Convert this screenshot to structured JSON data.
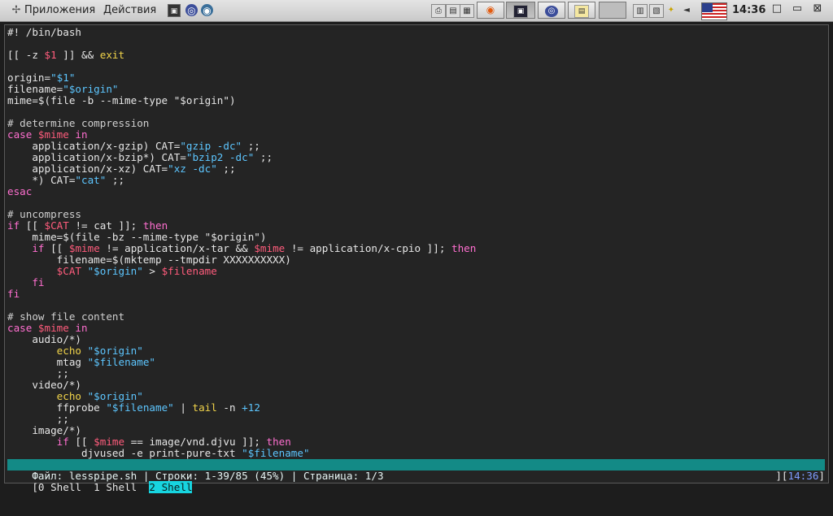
{
  "panel": {
    "menus": [
      "Приложения",
      "Действия"
    ],
    "quicklaunch": [
      {
        "icon": "terminal-icon",
        "glyph": "▣"
      },
      {
        "icon": "app-launcher-icon",
        "glyph": "◎"
      },
      {
        "icon": "browser-icon",
        "glyph": "◉"
      }
    ],
    "tray_left": [
      {
        "icon": "printer-icon",
        "glyph": "⎙"
      },
      {
        "icon": "notes-icon",
        "glyph": "▤"
      },
      {
        "icon": "network-icon",
        "glyph": "▦"
      }
    ],
    "tasks": [
      {
        "name": "task-firefox",
        "glyph": "◉"
      },
      {
        "name": "task-terminal",
        "glyph": "▣"
      },
      {
        "name": "task-app",
        "glyph": "◎"
      },
      {
        "name": "task-editor",
        "glyph": "▤"
      }
    ],
    "tray_right": [
      {
        "icon": "files-icon",
        "glyph": "▥"
      },
      {
        "icon": "clipboard-icon",
        "glyph": "▧"
      },
      {
        "icon": "weather-icon",
        "glyph": "✦"
      },
      {
        "icon": "volume-icon",
        "glyph": "◄"
      }
    ],
    "clock": "14:36",
    "window_buttons": {
      "maximize": "□",
      "minimize": "▭",
      "close": "⊠"
    }
  },
  "terminal": {
    "lines": [
      [
        [
          "plain",
          "#! /bin/bash"
        ]
      ],
      [],
      [
        [
          "plain",
          "[[ -z "
        ],
        [
          "var",
          "$1"
        ],
        [
          "plain",
          " ]] && "
        ],
        [
          "cmd",
          "exit"
        ]
      ],
      [],
      [
        [
          "plain",
          "origin="
        ],
        [
          "str",
          "\"$1\""
        ]
      ],
      [
        [
          "plain",
          "filename="
        ],
        [
          "str",
          "\"$origin\""
        ]
      ],
      [
        [
          "plain",
          "mime=$(file -b --mime-type \"$origin\")"
        ]
      ],
      [],
      [
        [
          "comment",
          "# determine compression"
        ]
      ],
      [
        [
          "kw",
          "case "
        ],
        [
          "var",
          "$mime"
        ],
        [
          "kw",
          " in"
        ]
      ],
      [
        [
          "plain",
          "    application/x-gzip) CAT="
        ],
        [
          "str",
          "\"gzip -dc\""
        ],
        [
          "plain",
          " ;;"
        ]
      ],
      [
        [
          "plain",
          "    application/x-bzip*) CAT="
        ],
        [
          "str",
          "\"bzip2 -dc\""
        ],
        [
          "plain",
          " ;;"
        ]
      ],
      [
        [
          "plain",
          "    application/x-xz) CAT="
        ],
        [
          "str",
          "\"xz -dc\""
        ],
        [
          "plain",
          " ;;"
        ]
      ],
      [
        [
          "plain",
          "    *) CAT="
        ],
        [
          "str",
          "\"cat\""
        ],
        [
          "plain",
          " ;;"
        ]
      ],
      [
        [
          "kw",
          "esac"
        ]
      ],
      [],
      [
        [
          "comment",
          "# uncompress"
        ]
      ],
      [
        [
          "kw",
          "if"
        ],
        [
          "plain",
          " [[ "
        ],
        [
          "var",
          "$CAT"
        ],
        [
          "plain",
          " != cat ]]; "
        ],
        [
          "kw",
          "then"
        ]
      ],
      [
        [
          "plain",
          "    mime=$(file -bz --mime-type \"$origin\")"
        ]
      ],
      [
        [
          "plain",
          "    "
        ],
        [
          "kw",
          "if"
        ],
        [
          "plain",
          " [[ "
        ],
        [
          "var",
          "$mime"
        ],
        [
          "plain",
          " != application/x-tar && "
        ],
        [
          "var",
          "$mime"
        ],
        [
          "plain",
          " != application/x-cpio ]]; "
        ],
        [
          "kw",
          "then"
        ]
      ],
      [
        [
          "plain",
          "        filename=$(mktemp --tmpdir XXXXXXXXXX)"
        ]
      ],
      [
        [
          "plain",
          "        "
        ],
        [
          "var",
          "$CAT"
        ],
        [
          "str",
          " \"$origin\""
        ],
        [
          "plain",
          " > "
        ],
        [
          "var",
          "$filename"
        ]
      ],
      [
        [
          "plain",
          "    "
        ],
        [
          "kw",
          "fi"
        ]
      ],
      [
        [
          "kw",
          "fi"
        ]
      ],
      [],
      [
        [
          "comment",
          "# show file content"
        ]
      ],
      [
        [
          "kw",
          "case "
        ],
        [
          "var",
          "$mime"
        ],
        [
          "kw",
          " in"
        ]
      ],
      [
        [
          "plain",
          "    audio/*)"
        ]
      ],
      [
        [
          "plain",
          "        "
        ],
        [
          "cmd",
          "echo"
        ],
        [
          "str",
          " \"$origin\""
        ]
      ],
      [
        [
          "plain",
          "        mtag "
        ],
        [
          "str",
          "\"$filename\""
        ]
      ],
      [
        [
          "plain",
          "        ;;"
        ]
      ],
      [
        [
          "plain",
          "    video/*)"
        ]
      ],
      [
        [
          "plain",
          "        "
        ],
        [
          "cmd",
          "echo"
        ],
        [
          "str",
          " \"$origin\""
        ]
      ],
      [
        [
          "plain",
          "        ffprobe "
        ],
        [
          "str",
          "\"$filename\""
        ],
        [
          "plain",
          " | "
        ],
        [
          "cmd",
          "tail"
        ],
        [
          "plain",
          " -n "
        ],
        [
          "num",
          "+12"
        ]
      ],
      [
        [
          "plain",
          "        ;;"
        ]
      ],
      [
        [
          "plain",
          "    image/*)"
        ]
      ],
      [
        [
          "plain",
          "        "
        ],
        [
          "kw",
          "if"
        ],
        [
          "plain",
          " [[ "
        ],
        [
          "var",
          "$mime"
        ],
        [
          "plain",
          " == image/vnd.djvu ]]; "
        ],
        [
          "kw",
          "then"
        ]
      ],
      [
        [
          "plain",
          "            djvused -e print-pure-txt "
        ],
        [
          "str",
          "\"$filename\""
        ]
      ]
    ],
    "status": "Файл: lesspipe.sh | Строки: 1-39/85 (45%) | Страница: 1/3",
    "screens": {
      "left": "[0 Shell  1 Shell  ",
      "current": "2 Shell",
      "right_prefix": "][",
      "time": "14:36",
      "right_suffix": "]"
    }
  }
}
